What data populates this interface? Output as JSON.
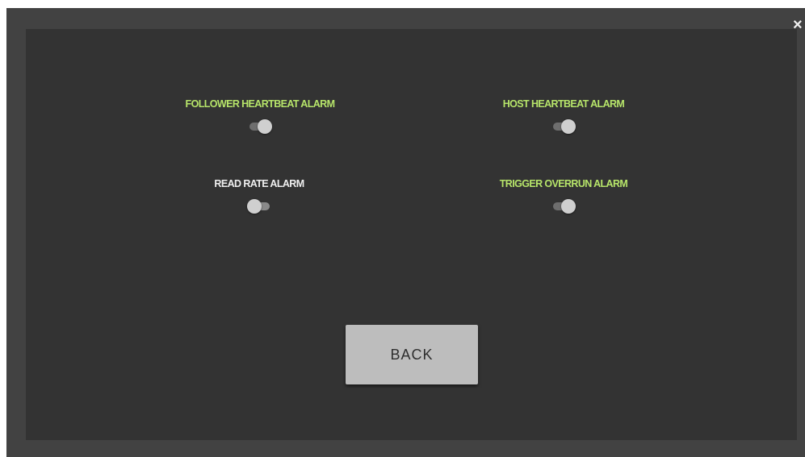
{
  "dialog": {
    "close_glyph": "×",
    "toggles": [
      {
        "label": "FOLLOWER HEARTBEAT ALARM",
        "state": "on"
      },
      {
        "label": "HOST HEARTBEAT ALARM",
        "state": "on"
      },
      {
        "label": "READ RATE ALARM",
        "state": "off"
      },
      {
        "label": "TRIGGER OVERRUN ALARM",
        "state": "on"
      }
    ],
    "back_label": "BACK"
  },
  "colors": {
    "label_on": "#b7e56a",
    "label_off": "#f0f0f0",
    "panel": "#333333",
    "frame": "#424242",
    "button": "#bdbdbd"
  }
}
